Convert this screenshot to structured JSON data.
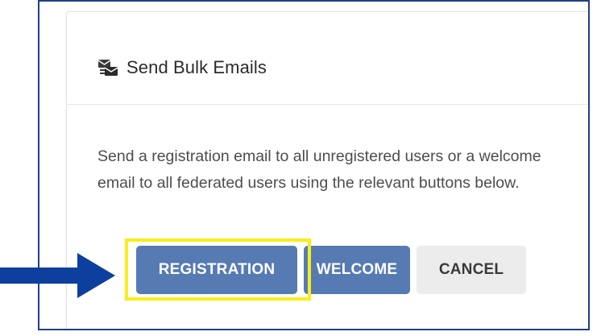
{
  "dialog": {
    "title": "Send Bulk Emails",
    "icon": "bulk-email-icon",
    "description": "Send a registration email to all unregistered users or a welcome email to all federated users using the relevant buttons below."
  },
  "buttons": {
    "registration_label": "REGISTRATION",
    "welcome_label": "WELCOME",
    "cancel_label": "CANCEL"
  },
  "annotation": {
    "arrow_icon": "arrow-right-icon",
    "arrow_color": "#0d3f9e",
    "highlight_color": "#f7ef1a"
  },
  "colors": {
    "primary_button": "#567bb3",
    "cancel_button": "#ececec",
    "frame_border": "#1f3f88"
  }
}
